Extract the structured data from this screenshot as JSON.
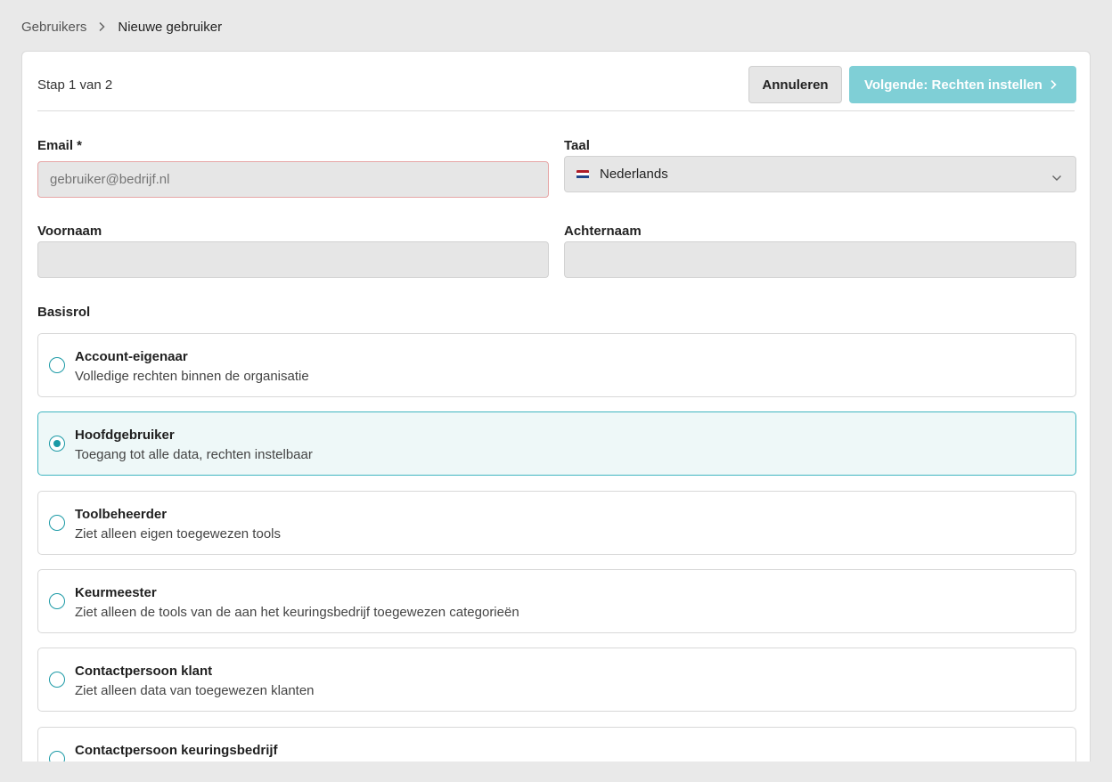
{
  "breadcrumb": {
    "parent": "Gebruikers",
    "current": "Nieuwe gebruiker"
  },
  "header": {
    "step_text": "Stap 1 van 2",
    "cancel_label": "Annuleren",
    "next_label": "Volgende: Rechten instellen"
  },
  "form": {
    "email_label": "Email *",
    "email_placeholder": "gebruiker@bedrijf.nl",
    "language_label": "Taal",
    "language_value": "Nederlands",
    "firstname_label": "Voornaam",
    "lastname_label": "Achternaam",
    "role_label": "Basisrol"
  },
  "roles": [
    {
      "title": "Account-eigenaar",
      "description": "Volledige rechten binnen de organisatie",
      "selected": false
    },
    {
      "title": "Hoofdgebruiker",
      "description": "Toegang tot alle data, rechten instelbaar",
      "selected": true
    },
    {
      "title": "Toolbeheerder",
      "description": "Ziet alleen eigen toegewezen tools",
      "selected": false
    },
    {
      "title": "Keurmeester",
      "description": "Ziet alleen de tools van de aan het keuringsbedrijf toegewezen categorieën",
      "selected": false
    },
    {
      "title": "Contactpersoon klant",
      "description": "Ziet alleen data van toegewezen klanten",
      "selected": false
    },
    {
      "title": "Contactpersoon keuringsbedrijf",
      "description": "",
      "selected": false
    }
  ],
  "colors": {
    "accent": "#1c9aa6",
    "next_button": "#7fcfd6",
    "selected_bg": "#eef8f8",
    "error_border": "#e6a6a6"
  },
  "icons": {
    "breadcrumb_separator": "chevron-right-icon",
    "next_button": "chevron-right-icon",
    "language_select": "chevron-down-icon",
    "language_flag": "flag-nl-icon"
  }
}
